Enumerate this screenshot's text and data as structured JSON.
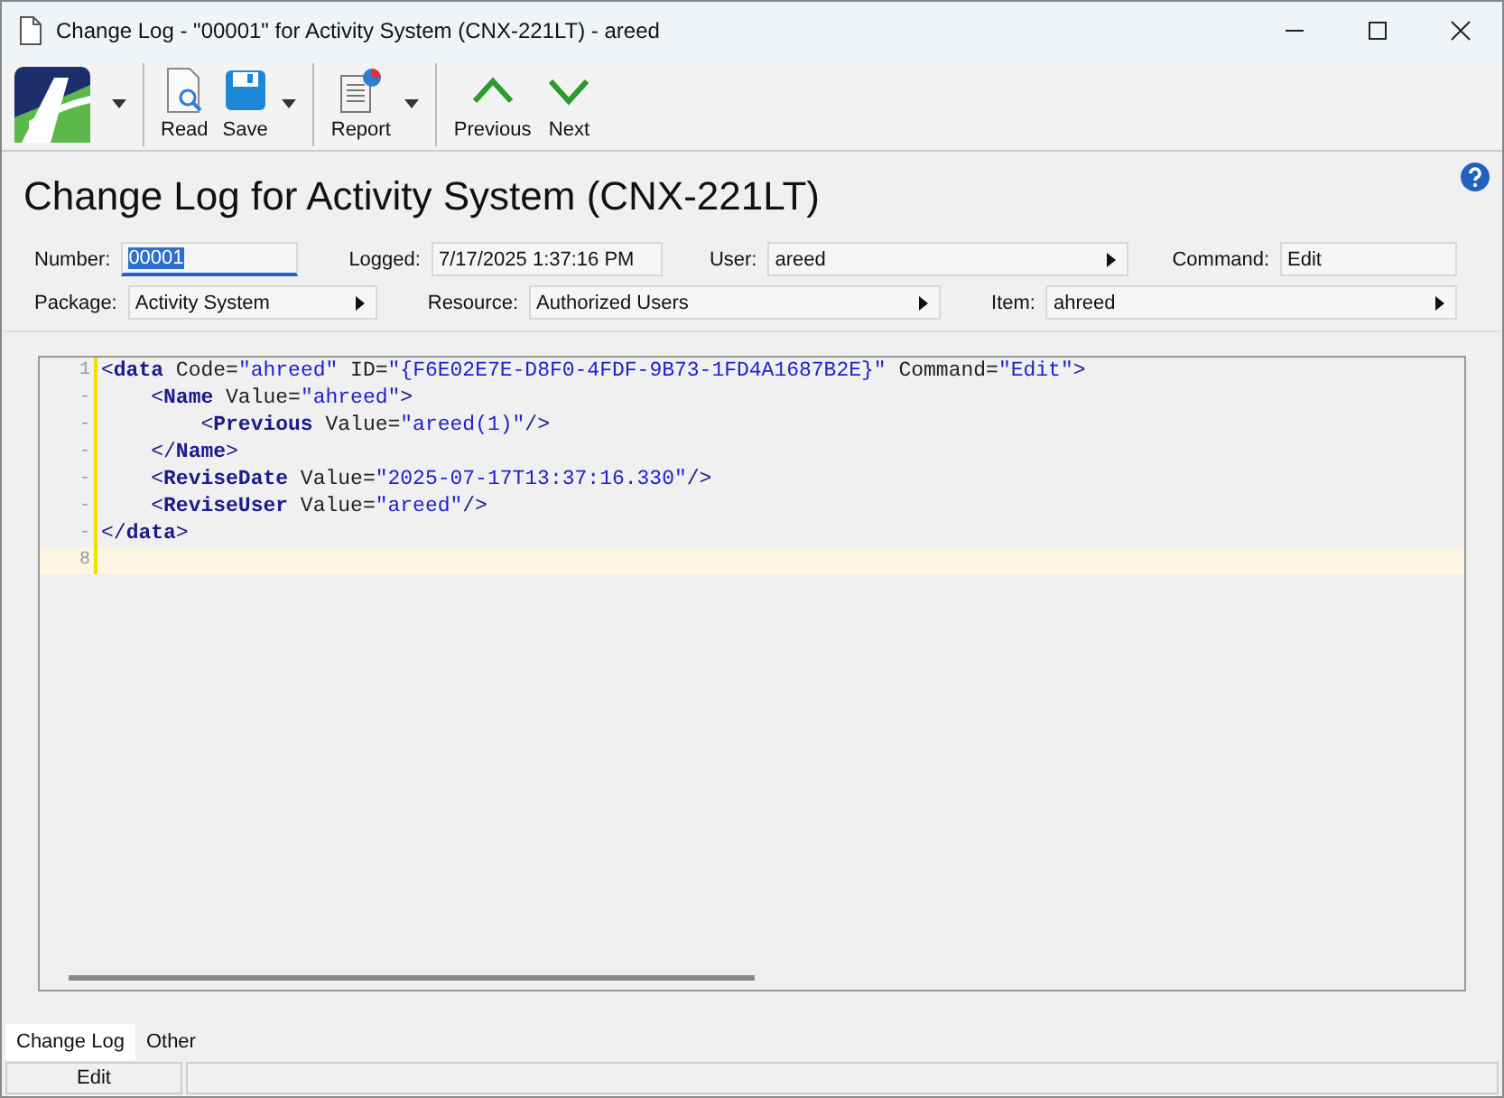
{
  "window": {
    "title": "Change Log - \"00001\" for Activity System (CNX-221LT) - areed"
  },
  "toolbar": [
    {
      "label": "Read",
      "kind": "read",
      "dropdown": false
    },
    {
      "label": "Save",
      "kind": "save",
      "dropdown": true
    },
    {
      "label": "Report",
      "kind": "report",
      "dropdown": true
    },
    {
      "label": "Previous",
      "kind": "up",
      "dropdown": false
    },
    {
      "label": "Next",
      "kind": "down",
      "dropdown": false
    }
  ],
  "heading": "Change Log for Activity System (CNX-221LT)",
  "fields": [
    [
      {
        "label": "Number:",
        "value": "00001",
        "kind": "selected"
      },
      {
        "label": "Logged:",
        "value": "7/17/2025 1:37:16 PM",
        "kind": "text"
      },
      {
        "label": "User:",
        "value": "areed",
        "kind": "picker"
      },
      {
        "label": "Command:",
        "value": "Edit",
        "kind": "text"
      }
    ],
    [
      {
        "label": "Package:",
        "value": "Activity System",
        "kind": "picker"
      },
      {
        "label": "Resource:",
        "value": "Authorized Users",
        "kind": "picker"
      },
      {
        "label": "Item:",
        "value": "ahreed",
        "kind": "picker"
      }
    ]
  ],
  "code": [
    {
      "gutter": "1",
      "current": false,
      "tokens": [
        {
          "kind": "punct",
          "text": "<"
        },
        {
          "kind": "tag",
          "text": "data"
        },
        {
          "kind": "attr",
          "text": " Code="
        },
        {
          "kind": "string",
          "text": "\"ahreed\""
        },
        {
          "kind": "attr",
          "text": " ID="
        },
        {
          "kind": "string",
          "text": "\"{F6E02E7E-D8F0-4FDF-9B73-1FD4A1687B2E}\""
        },
        {
          "kind": "attr",
          "text": " Command="
        },
        {
          "kind": "string",
          "text": "\"Edit\""
        },
        {
          "kind": "punct",
          "text": ">"
        }
      ]
    },
    {
      "gutter": "-",
      "current": false,
      "tokens": [
        {
          "kind": "punct",
          "text": "    <"
        },
        {
          "kind": "tag",
          "text": "Name"
        },
        {
          "kind": "attr",
          "text": " Value="
        },
        {
          "kind": "string",
          "text": "\"ahreed\""
        },
        {
          "kind": "punct",
          "text": ">"
        }
      ]
    },
    {
      "gutter": "-",
      "current": false,
      "tokens": [
        {
          "kind": "punct",
          "text": "        <"
        },
        {
          "kind": "tag",
          "text": "Previous"
        },
        {
          "kind": "attr",
          "text": " Value="
        },
        {
          "kind": "string",
          "text": "\"areed(1)\""
        },
        {
          "kind": "punct",
          "text": "/>"
        }
      ]
    },
    {
      "gutter": "-",
      "current": false,
      "tokens": [
        {
          "kind": "punct",
          "text": "    </"
        },
        {
          "kind": "tag",
          "text": "Name"
        },
        {
          "kind": "punct",
          "text": ">"
        }
      ]
    },
    {
      "gutter": "-",
      "current": false,
      "tokens": [
        {
          "kind": "punct",
          "text": "    <"
        },
        {
          "kind": "tag",
          "text": "ReviseDate"
        },
        {
          "kind": "attr",
          "text": " Value="
        },
        {
          "kind": "string",
          "text": "\"2025-07-17T13:37:16.330\""
        },
        {
          "kind": "punct",
          "text": "/>"
        }
      ]
    },
    {
      "gutter": "-",
      "current": false,
      "tokens": [
        {
          "kind": "punct",
          "text": "    <"
        },
        {
          "kind": "tag",
          "text": "ReviseUser"
        },
        {
          "kind": "attr",
          "text": " Value="
        },
        {
          "kind": "string",
          "text": "\"areed\""
        },
        {
          "kind": "punct",
          "text": "/>"
        }
      ]
    },
    {
      "gutter": "-",
      "current": false,
      "tokens": [
        {
          "kind": "punct",
          "text": "</"
        },
        {
          "kind": "tag",
          "text": "data"
        },
        {
          "kind": "punct",
          "text": ">"
        }
      ]
    },
    {
      "gutter": "8",
      "current": true
    }
  ],
  "tabs": [
    {
      "label": "Change Log",
      "selected": true
    },
    {
      "label": "Other",
      "selected": false
    }
  ],
  "status_bar": {
    "mode": "Edit"
  }
}
